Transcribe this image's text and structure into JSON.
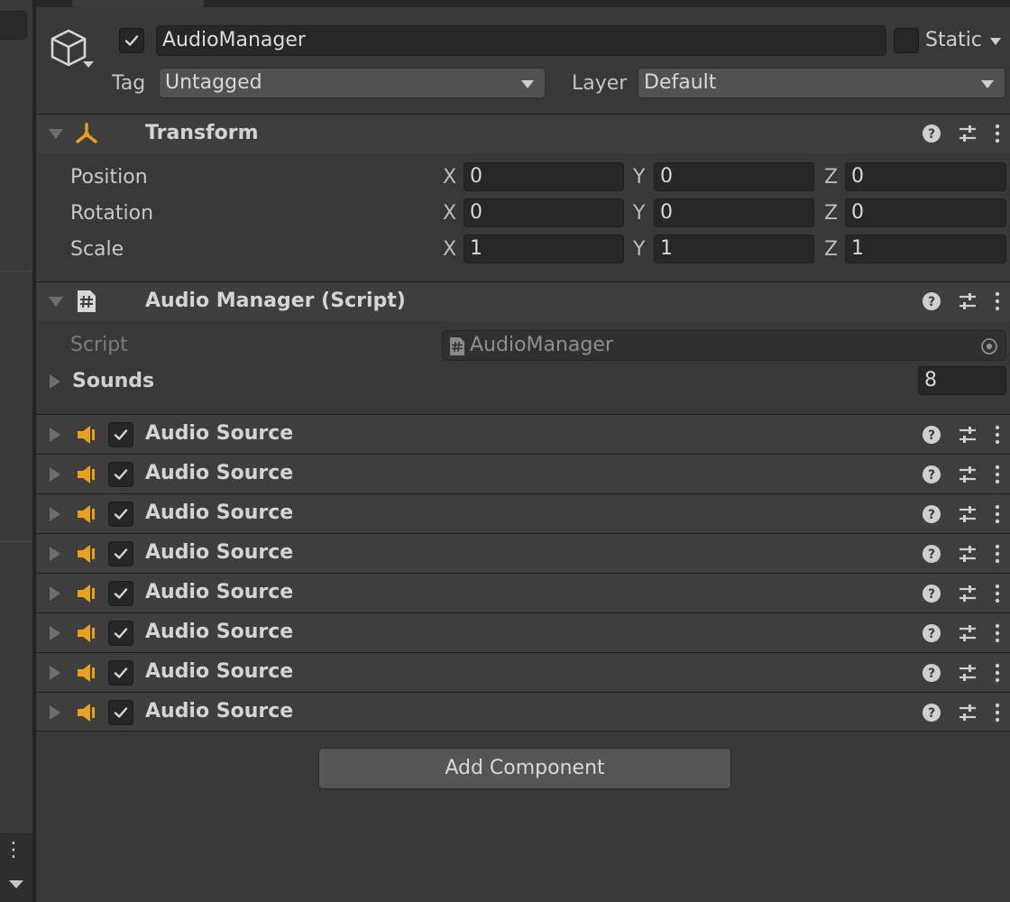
{
  "gameobject": {
    "name": "AudioManager",
    "active": true,
    "static_label": "Static",
    "tag_label": "Tag",
    "tag_value": "Untagged",
    "layer_label": "Layer",
    "layer_value": "Default"
  },
  "transform": {
    "title": "Transform",
    "rows": [
      {
        "label": "Position",
        "x": "0",
        "y": "0",
        "z": "0"
      },
      {
        "label": "Rotation",
        "x": "0",
        "y": "0",
        "z": "0"
      },
      {
        "label": "Scale",
        "x": "1",
        "y": "1",
        "z": "1"
      }
    ],
    "axes": {
      "x": "X",
      "y": "Y",
      "z": "Z"
    }
  },
  "audio_manager": {
    "title": "Audio Manager (Script)",
    "script_label": "Script",
    "script_value": "AudioManager",
    "sounds_label": "Sounds",
    "sounds_count": "8"
  },
  "audio_sources": [
    {
      "title": "Audio Source",
      "enabled": true
    },
    {
      "title": "Audio Source",
      "enabled": true
    },
    {
      "title": "Audio Source",
      "enabled": true
    },
    {
      "title": "Audio Source",
      "enabled": true
    },
    {
      "title": "Audio Source",
      "enabled": true
    },
    {
      "title": "Audio Source",
      "enabled": true
    },
    {
      "title": "Audio Source",
      "enabled": true
    },
    {
      "title": "Audio Source",
      "enabled": true
    }
  ],
  "add_component_label": "Add Component",
  "icons": {
    "gameobject": "cube-icon",
    "transform": "transform-icon",
    "script": "script-hash-icon",
    "audio_source": "speaker-icon",
    "help": "help-icon",
    "presets": "sliders-icon",
    "more": "kebab-menu-icon"
  },
  "colors": {
    "accent_audio": "#e8a21a",
    "accent_transform": "#e8a21a",
    "background": "#383838"
  }
}
